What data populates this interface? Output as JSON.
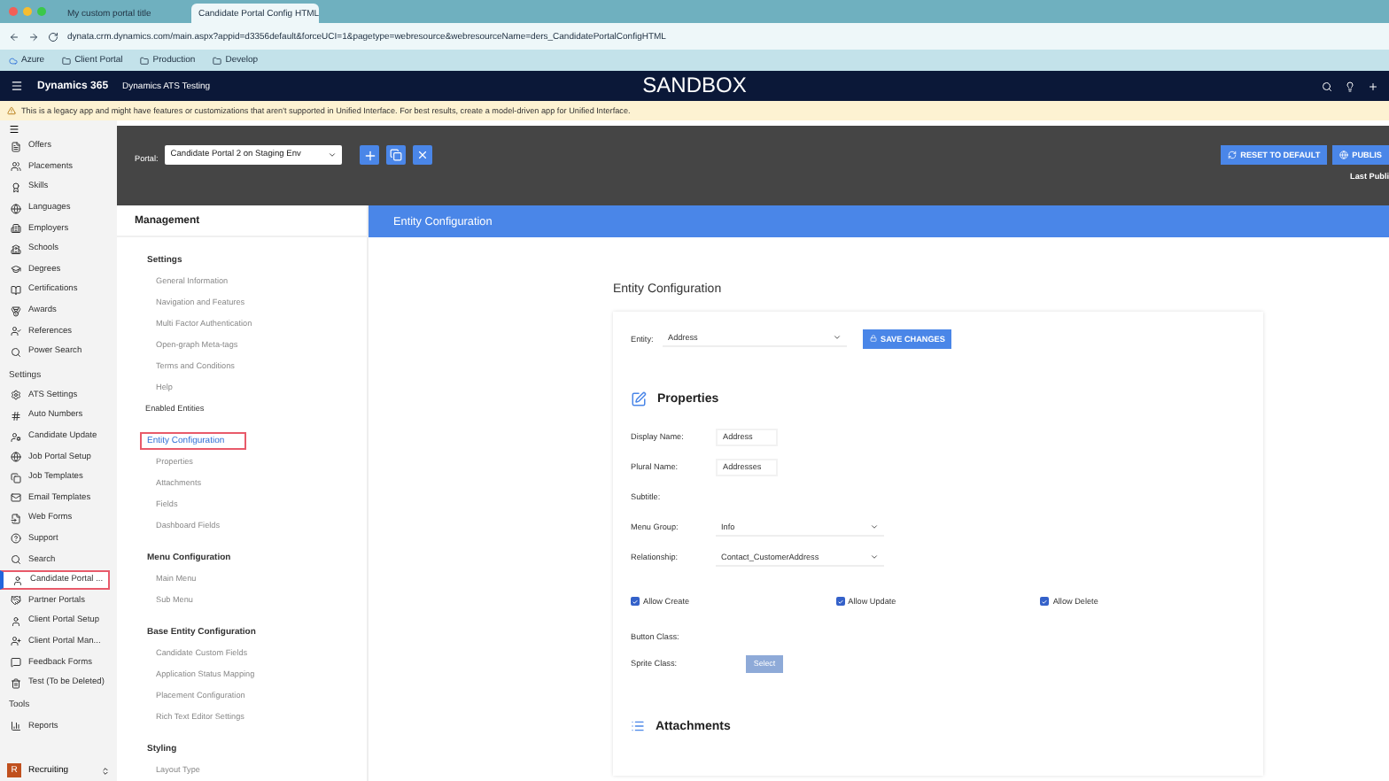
{
  "browser": {
    "tabs": [
      {
        "title": "My custom portal title",
        "selected": false
      },
      {
        "title": "Candidate Portal Config HTML",
        "selected": true
      }
    ],
    "url": "dynata.crm.dynamics.com/main.aspx?appid=d3356default&forceUCI=1&pagetype=webresource&webresourceName=ders_CandidatePortalConfigHTML",
    "bookmarks": [
      "Azure",
      "Client Portal",
      "Production",
      "Develop"
    ]
  },
  "app_header": {
    "app_name": "Dynamics 365",
    "app_title": "Dynamics ATS Testing",
    "environment": "SANDBOX"
  },
  "warning": "This is a legacy app and might have features or customizations that aren't supported in Unified Interface. For best results, create a model-driven app for Unified Interface.",
  "sidebar": {
    "groups": [
      {
        "items": [
          {
            "label": "Offers",
            "selected": false
          },
          {
            "label": "Placements",
            "selected": false
          },
          {
            "label": "Skills",
            "selected": false
          },
          {
            "label": "Languages",
            "selected": false
          },
          {
            "label": "Employers",
            "selected": false
          },
          {
            "label": "Schools",
            "selected": false
          },
          {
            "label": "Degrees",
            "selected": false
          },
          {
            "label": "Certifications",
            "selected": false
          },
          {
            "label": "Awards",
            "selected": false
          },
          {
            "label": "References",
            "selected": false
          },
          {
            "label": "Power Search",
            "selected": false
          }
        ]
      },
      {
        "heading": "Settings",
        "items": [
          {
            "label": "ATS Settings",
            "selected": false
          },
          {
            "label": "Auto Numbers",
            "selected": false
          },
          {
            "label": "Candidate Update",
            "selected": false
          },
          {
            "label": "Job Portal Setup",
            "selected": false
          },
          {
            "label": "Job Templates",
            "selected": false
          },
          {
            "label": "Email Templates",
            "selected": false
          },
          {
            "label": "Web Forms",
            "selected": false
          },
          {
            "label": "Support",
            "selected": false
          },
          {
            "label": "Search",
            "selected": false
          },
          {
            "label": "Candidate Portal ...",
            "selected": true
          },
          {
            "label": "Partner Portals",
            "selected": false
          },
          {
            "label": "Client Portal Setup",
            "selected": false
          },
          {
            "label": "Client Portal Man...",
            "selected": false
          },
          {
            "label": "Feedback Forms",
            "selected": false
          },
          {
            "label": "Test (To be Deleted)",
            "selected": false
          }
        ]
      },
      {
        "heading": "Tools",
        "items": [
          {
            "label": "Reports",
            "selected": false
          }
        ]
      }
    ],
    "area": {
      "initial": "R",
      "label": "Recruiting"
    }
  },
  "toolbar": {
    "portal_label": "Portal:",
    "portal_value": "Candidate Portal 2 on Staging Env",
    "reset_button": "RESET TO DEFAULT",
    "publish_button": "PUBLIS",
    "last_published": "Last Publi"
  },
  "management": {
    "title": "Management",
    "sections": [
      {
        "heading": "Settings",
        "selected": false,
        "items": [
          {
            "label": "General Information",
            "kind": "link"
          },
          {
            "label": "Navigation and Features",
            "kind": "link"
          },
          {
            "label": "Multi Factor Authentication",
            "kind": "link"
          },
          {
            "label": "Open-graph Meta-tags",
            "kind": "link"
          },
          {
            "label": "Terms and Conditions",
            "kind": "link"
          },
          {
            "label": "Help",
            "kind": "link"
          },
          {
            "label": "Enabled Entities",
            "kind": "strong"
          }
        ]
      },
      {
        "heading": "Entity Configuration",
        "selected": true,
        "items": [
          {
            "label": "Properties",
            "kind": "link"
          },
          {
            "label": "Attachments",
            "kind": "link"
          },
          {
            "label": "Fields",
            "kind": "link"
          },
          {
            "label": "Dashboard Fields",
            "kind": "link"
          }
        ]
      },
      {
        "heading": "Menu Configuration",
        "selected": false,
        "items": [
          {
            "label": "Main Menu",
            "kind": "link"
          },
          {
            "label": "Sub Menu",
            "kind": "link"
          }
        ]
      },
      {
        "heading": "Base Entity Configuration",
        "selected": false,
        "items": [
          {
            "label": "Candidate Custom Fields",
            "kind": "link"
          },
          {
            "label": "Application Status Mapping",
            "kind": "link"
          },
          {
            "label": "Placement Configuration",
            "kind": "link"
          },
          {
            "label": "Rich Text Editor Settings",
            "kind": "link"
          }
        ]
      },
      {
        "heading": "Styling",
        "selected": false,
        "items": [
          {
            "label": "Layout Type",
            "kind": "link"
          }
        ]
      }
    ]
  },
  "main": {
    "header": "Entity Configuration",
    "title": "Entity Configuration",
    "entity": {
      "label": "Entity:",
      "value": "Address"
    },
    "save_button": "SAVE CHANGES",
    "properties_heading": "Properties",
    "fields": [
      {
        "label": "Display Name:",
        "value": "Address",
        "kind": "text"
      },
      {
        "label": "Plural Name:",
        "value": "Addresses",
        "kind": "text"
      },
      {
        "label": "Subtitle:",
        "kind": "text"
      },
      {
        "label": "Menu Group:",
        "value": "Info",
        "kind": "select"
      },
      {
        "label": "Relationship:",
        "value": "Contact_CustomerAddress",
        "kind": "select"
      }
    ],
    "checkboxes": [
      {
        "label": "Allow Create",
        "checked": true
      },
      {
        "label": "Allow Update",
        "checked": true
      },
      {
        "label": "Allow Delete",
        "checked": true
      }
    ],
    "button_class_label": "Button Class:",
    "sprite_class_label": "Sprite Class:",
    "select_button": "Select",
    "attachments_heading": "Attachments"
  }
}
